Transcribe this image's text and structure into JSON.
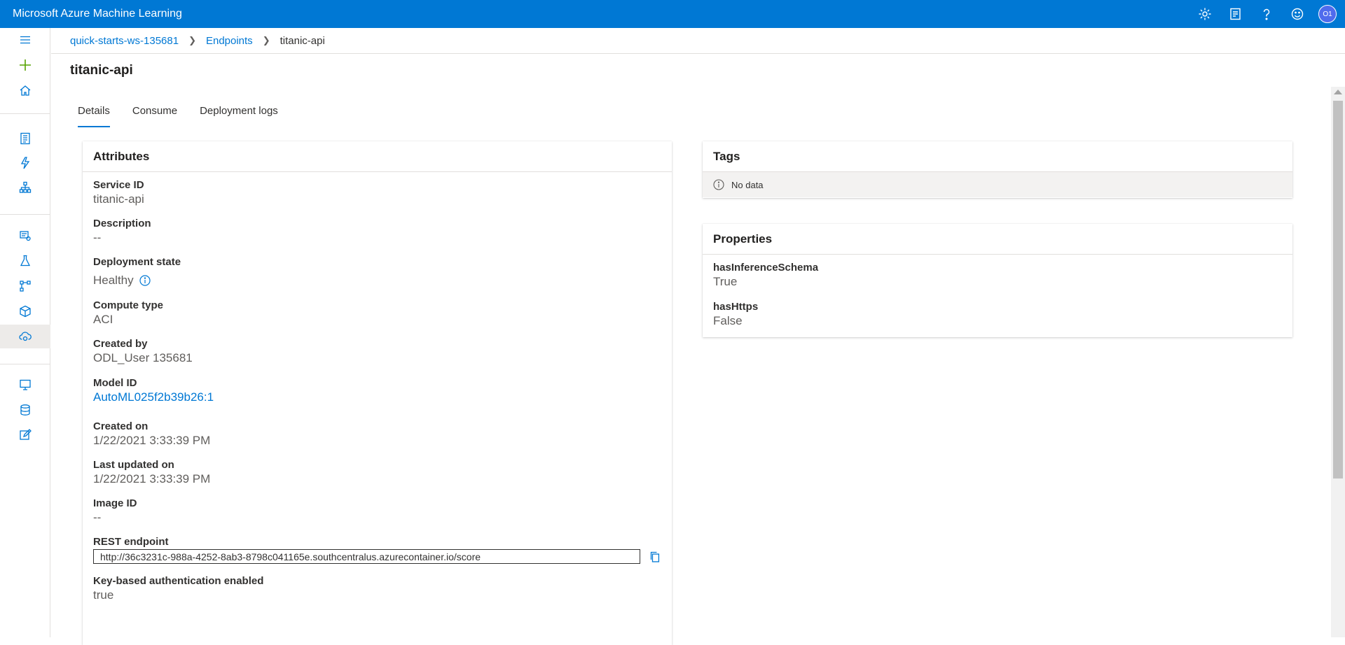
{
  "app": {
    "title": "Microsoft Azure Machine Learning",
    "user_initials": "O1"
  },
  "breadcrumb": {
    "workspace": "quick-starts-ws-135681",
    "section": "Endpoints",
    "current": "titanic-api"
  },
  "page": {
    "title": "titanic-api"
  },
  "tabs": [
    {
      "label": "Details",
      "active": true
    },
    {
      "label": "Consume",
      "active": false
    },
    {
      "label": "Deployment logs",
      "active": false
    }
  ],
  "attributes": {
    "header": "Attributes",
    "service_id_label": "Service ID",
    "service_id": "titanic-api",
    "description_label": "Description",
    "description": "--",
    "deployment_state_label": "Deployment state",
    "deployment_state": "Healthy",
    "compute_type_label": "Compute type",
    "compute_type": "ACI",
    "created_by_label": "Created by",
    "created_by": "ODL_User 135681",
    "model_id_label": "Model ID",
    "model_id": "AutoML025f2b39b26:1",
    "created_on_label": "Created on",
    "created_on": "1/22/2021 3:33:39 PM",
    "last_updated_label": "Last updated on",
    "last_updated": "1/22/2021 3:33:39 PM",
    "image_id_label": "Image ID",
    "image_id": "--",
    "rest_endpoint_label": "REST endpoint",
    "rest_endpoint": "http://36c3231c-988a-4252-8ab3-8798c041165e.southcentralus.azurecontainer.io/score",
    "key_auth_label": "Key-based authentication enabled",
    "key_auth": "true"
  },
  "tags": {
    "header": "Tags",
    "empty_text": "No data"
  },
  "properties": {
    "header": "Properties",
    "items": [
      {
        "label": "hasInferenceSchema",
        "value": "True"
      },
      {
        "label": "hasHttps",
        "value": "False"
      }
    ]
  },
  "colors": {
    "brand": "#0078d4",
    "rail_active": "#edebe9"
  }
}
